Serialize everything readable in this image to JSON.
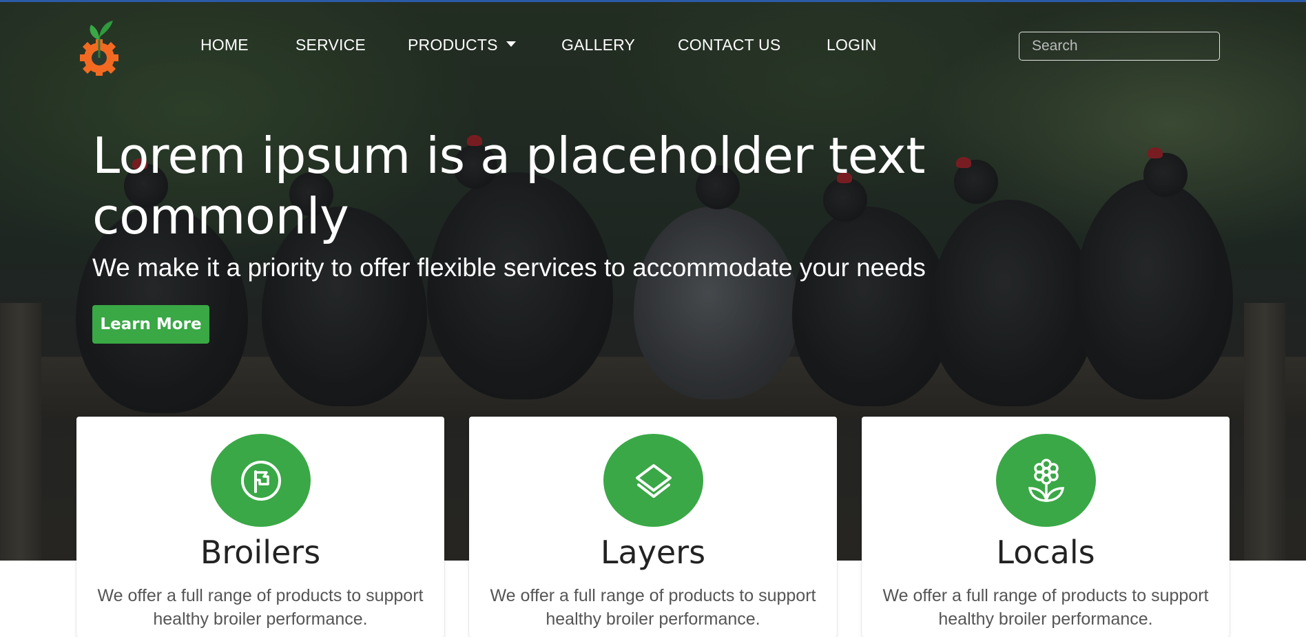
{
  "nav": {
    "items": [
      {
        "label": "HOME"
      },
      {
        "label": "SERVICE"
      },
      {
        "label": "PRODUCTS"
      },
      {
        "label": "GALLERY"
      },
      {
        "label": "CONTACT US"
      },
      {
        "label": "LOGIN"
      }
    ],
    "search_placeholder": "Search",
    "logo_icon": "gear-sprout-logo-icon"
  },
  "hero": {
    "title": "Lorem ipsum is a placeholder text commonly",
    "subtitle": "We make it a priority to offer flexible services to accommodate your needs",
    "button_label": "Learn More"
  },
  "cards": [
    {
      "title": "Broilers",
      "text": "We offer a full range of products to support healthy broiler performance.",
      "icon": "flag-circle-icon"
    },
    {
      "title": "Layers",
      "text": "We offer a full range of products to support healthy broiler performance.",
      "icon": "layers-icon"
    },
    {
      "title": "Locals",
      "text": "We offer a full range of products to support healthy broiler performance.",
      "icon": "flower-icon"
    }
  ],
  "colors": {
    "accent": "#39a845",
    "logo_orange": "#f26a21",
    "top_line": "#2b5aa8"
  }
}
